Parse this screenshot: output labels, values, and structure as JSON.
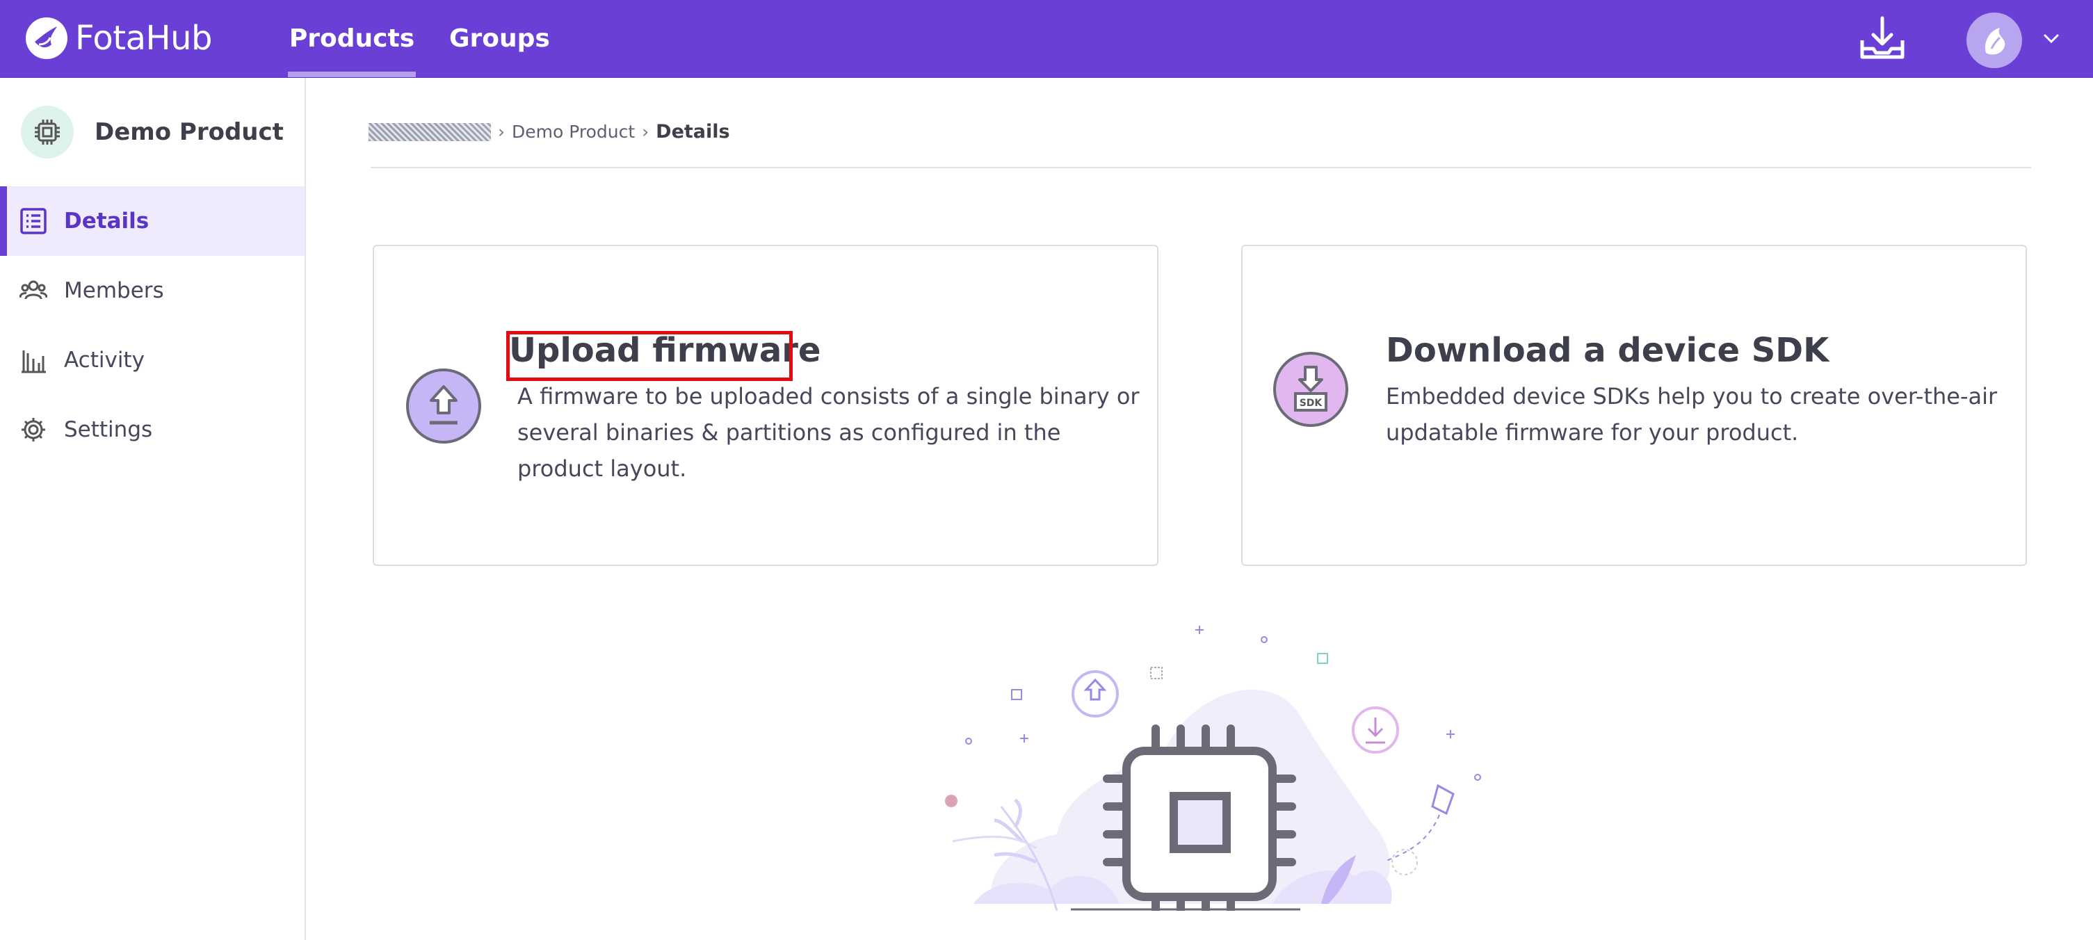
{
  "topbar": {
    "brand": "FotaHub",
    "tabs": [
      {
        "label": "Products",
        "active": true
      },
      {
        "label": "Groups",
        "active": false
      }
    ],
    "accent_color": "#6a3fd6"
  },
  "sidebar": {
    "product_name": "Demo Product",
    "items": [
      {
        "label": "Details",
        "icon": "list-icon",
        "active": true
      },
      {
        "label": "Members",
        "icon": "people-icon",
        "active": false
      },
      {
        "label": "Activity",
        "icon": "bar-chart-icon",
        "active": false
      },
      {
        "label": "Settings",
        "icon": "gear-icon",
        "active": false
      }
    ]
  },
  "breadcrumb": {
    "parent": "Demo Product",
    "current": "Details"
  },
  "cards": {
    "upload": {
      "title": "Upload firmware",
      "description": "A firmware to be uploaded consists of a single binary or several binaries & partitions as configured in the product layout."
    },
    "sdk": {
      "title": "Download a device SDK",
      "description": "Embedded device SDKs help you to create over-the-air updatable firmware for your product.",
      "icon_label": "SDK"
    }
  }
}
